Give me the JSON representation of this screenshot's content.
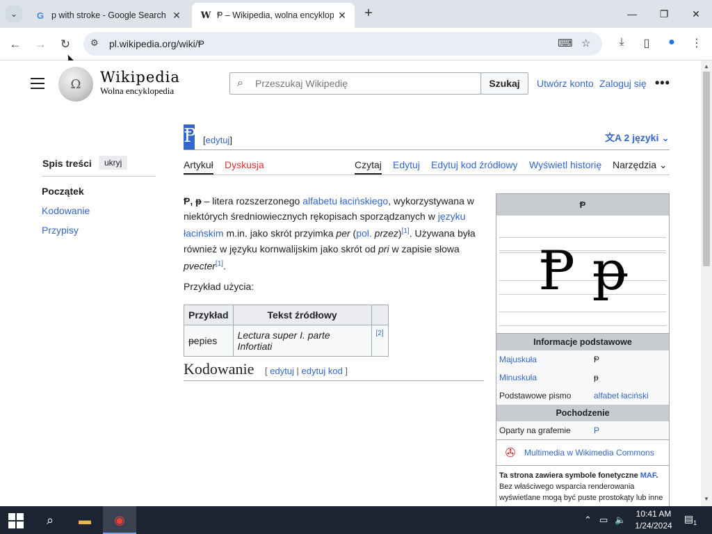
{
  "browser": {
    "tabs": [
      {
        "title": "p with stroke - Google Search",
        "favicon": "G"
      },
      {
        "title": "Ᵽ – Wikipedia, wolna encyklope",
        "favicon": "W"
      }
    ],
    "address": "pl.wikipedia.org/wiki/Ᵽ"
  },
  "header": {
    "logo_word": "Wikipedia",
    "logo_tag": "Wolna encyklopedia",
    "search_placeholder": "Przeszukaj Wikipedię",
    "search_button": "Szukaj",
    "create_account": "Utwórz konto",
    "login": "Zaloguj się",
    "more": "•••"
  },
  "article": {
    "title": "Ᵽ",
    "title_edit": "edytuj",
    "lang_button": "2 języki",
    "tabs_left": [
      "Artykuł",
      "Dyskusja"
    ],
    "tabs_right": [
      "Czytaj",
      "Edytuj",
      "Edytuj kod źródłowy",
      "Wyświetl historię",
      "Narzędzia"
    ],
    "intro": {
      "bold": "Ᵽ, ᵽ",
      "t1": " – litera rozszerzonego ",
      "l1": "alfabetu łacińskiego",
      "t2": ", wykorzystywana w niektórych średniowiecznych rękopisach sporządzanych w ",
      "l2": "języku łacińskim",
      "t3": " m.in. jako skrót przyimka ",
      "i1": "per",
      "t4": " (",
      "l3": "pol.",
      "t5": " ",
      "i2": "przez",
      "t6": ")",
      "ref1": "[1]",
      "t7": ". Używana była również w języku kornwalijskim jako skrót od ",
      "i3": "pri",
      "t8": " w zapisie słowa ",
      "i4": "pvecter",
      "ref2": "[1]",
      "t9": "."
    },
    "usage_label": "Przykład użycia:",
    "table": {
      "headers": [
        "Przykład",
        "Tekst źródłowy",
        ""
      ],
      "row": [
        "ᵽepies",
        "Lectura super I. parte Infortiati",
        "[2]"
      ]
    },
    "section_heading": "Kodowanie",
    "section_edit": "edytuj",
    "section_edit_code": "edytuj kod"
  },
  "toc": {
    "title": "Spis treści",
    "hide": "ukryj",
    "items": [
      "Początek",
      "Kodowanie",
      "Przypisy"
    ]
  },
  "infobox": {
    "title": "Ᵽ",
    "glyphs": "Ᵽ ᵽ",
    "section_basic": "Informacje podstawowe",
    "rows": [
      {
        "k": "Majuskuła",
        "v": "Ᵽ"
      },
      {
        "k": "Minuskuła",
        "v": "ᵽ"
      },
      {
        "k": "Podstawowe pismo",
        "v": "alfabet łaciński"
      }
    ],
    "section_origin": "Pochodzenie",
    "origin_row": {
      "k": "Oparty na grafemie",
      "v": "P"
    },
    "commons": "Multimedia w Wikimedia Commons",
    "note_bold": "Ta strona zawiera symbole fonetyczne ",
    "note_link": "MAF",
    "note_rest": "Bez właściwego wsparcia renderowania wyświetlane mogą być puste prostokąty lub inne"
  },
  "taskbar": {
    "time": "10:41 AM",
    "date": "1/24/2024",
    "notifications": "1"
  },
  "colors": {
    "link": "#3366cc",
    "redlink": "#dd3333",
    "tabbar": "#dee3ea",
    "taskbar": "#1c2331"
  }
}
